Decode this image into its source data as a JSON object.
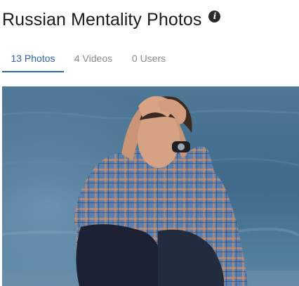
{
  "header": {
    "title": "Russian Mentality Photos",
    "info_icon": "info-icon"
  },
  "tabs": [
    {
      "label": "13 Photos",
      "active": true
    },
    {
      "label": "4 Videos",
      "active": false
    },
    {
      "label": "0 Users",
      "active": false
    }
  ],
  "colors": {
    "accent": "#2b64b3",
    "inactive_tab": "#8a8a8a"
  },
  "photo": {
    "subject": "man-with-head-in-hands"
  }
}
